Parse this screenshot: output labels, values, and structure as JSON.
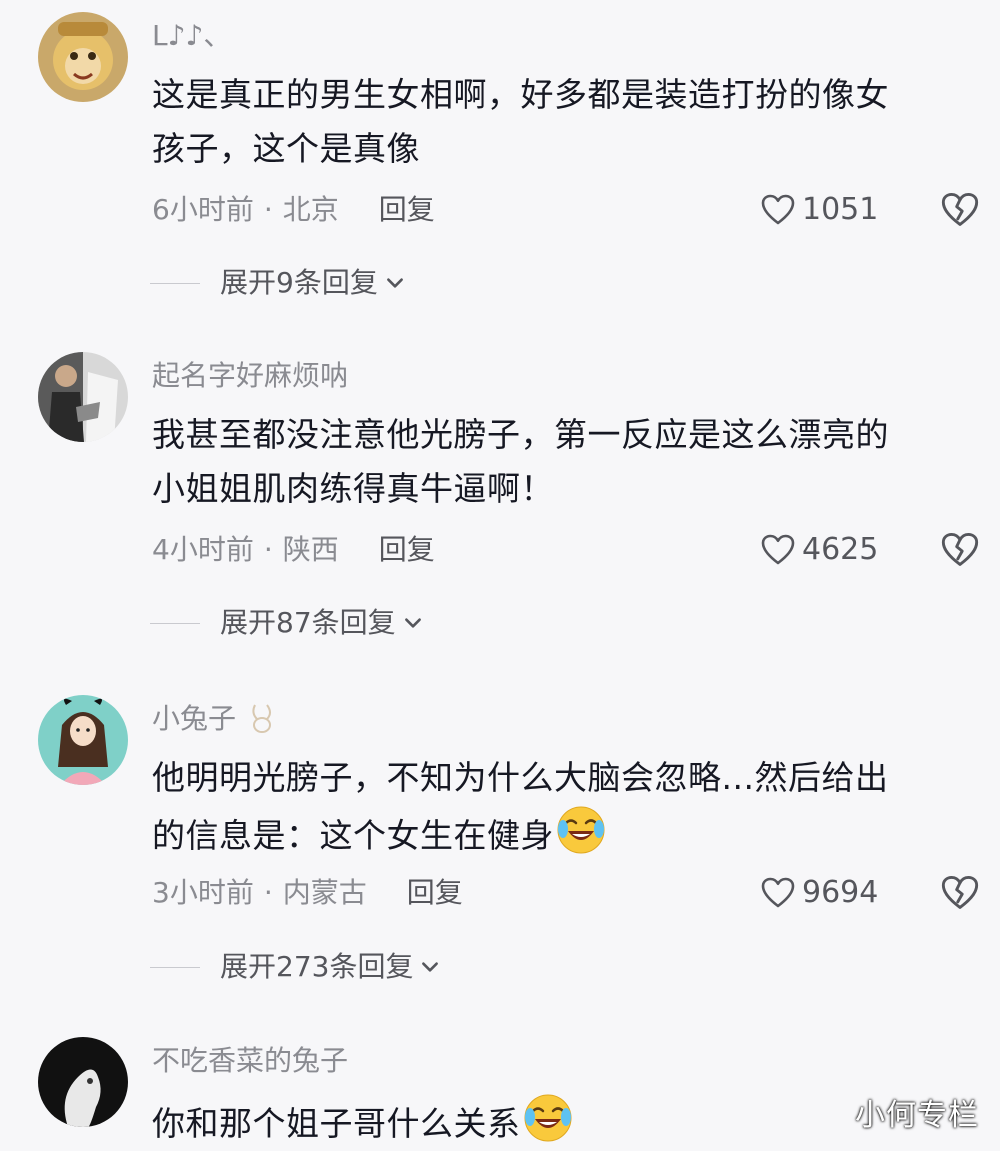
{
  "comments": [
    {
      "username": "L♪♪、",
      "text_lines": [
        "这是真正的男生女相啊，好多都是装造打扮的像女",
        "孩子，这个是真像"
      ],
      "time": "6小时前",
      "location": "北京",
      "reply_label": "回复",
      "likes": "1051",
      "expand_label": "展开9条回复"
    },
    {
      "username": "起名字好麻烦呐",
      "text_lines": [
        "我甚至都没注意他光膀子，第一反应是这么漂亮的",
        "小姐姐肌肉练得真牛逼啊！"
      ],
      "time": "4小时前",
      "location": "陕西",
      "reply_label": "回复",
      "likes": "4625",
      "expand_label": "展开87条回复"
    },
    {
      "username": "小兔子",
      "username_icon": "bunny-icon",
      "text_lines": [
        "他明明光膀子，不知为什么大脑会忽略...然后给出",
        "的信息是：这个女生在健身"
      ],
      "text_emoji": "laugh-cry-emoji",
      "time": "3小时前",
      "location": "内蒙古",
      "reply_label": "回复",
      "likes": "9694",
      "expand_label": "展开273条回复"
    },
    {
      "username": "不吃香菜的兔子",
      "text_lines": [
        "你和那个姐子哥什么关系"
      ],
      "text_emoji": "laugh-cry-emoji"
    }
  ],
  "separator_dot": "·",
  "watermark": "小何专栏",
  "icons": {
    "like": "heart-outline-icon",
    "dislike": "broken-heart-icon",
    "expand": "chevron-down-icon"
  },
  "colors": {
    "background": "#f7f7f9",
    "primary_text": "#161823",
    "secondary_text": "#8a8b91",
    "emoji_yellow": "#f9c93c"
  }
}
